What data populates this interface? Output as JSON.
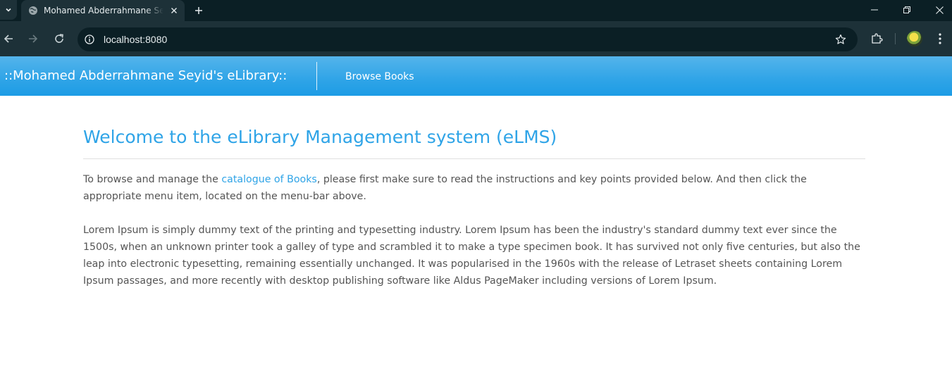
{
  "browser": {
    "tab": {
      "title": "Mohamed Abderrahmane Seyid's eLibrary",
      "favicon": "globe-icon"
    },
    "address_bar": {
      "url": "localhost:8080"
    },
    "icons": {
      "tab_list": "chevron-down-icon",
      "tab_close": "close-icon",
      "new_tab": "plus-icon",
      "minimize": "minimize-icon",
      "restore": "restore-icon",
      "close_window": "close-icon",
      "back": "back-arrow-icon",
      "forward": "forward-arrow-icon",
      "reload": "reload-icon",
      "site_info": "info-icon",
      "bookmark": "star-icon",
      "extensions": "puzzle-icon",
      "profile": "avatar",
      "menu": "more-vertical-icon"
    }
  },
  "navbar": {
    "brand": "::Mohamed Abderrahmane Seyid's eLibrary::",
    "links": [
      {
        "label": "Browse Books"
      }
    ]
  },
  "content": {
    "title": "Welcome to the eLibrary Management system (eLMS)",
    "intro": {
      "before_link": "To browse and manage the ",
      "link_text": "catalogue of Books",
      "after_link": ", please first make sure to read the instructions and key points provided below. And then click the appropriate menu item, located on the menu-bar above."
    },
    "lorem": "Lorem Ipsum is simply dummy text of the printing and typesetting industry. Lorem Ipsum has been the industry's standard dummy text ever since the 1500s, when an unknown printer took a galley of type and scrambled it to make a type specimen book. It has survived not only five centuries, but also the leap into electronic typesetting, remaining essentially unchanged. It was popularised in the 1960s with the release of Letraset sheets containing Lorem Ipsum passages, and more recently with desktop publishing software like Aldus PageMaker including versions of Lorem Ipsum."
  },
  "colors": {
    "chrome_dark": "#0b1f25",
    "chrome_toolbar": "#1d3138",
    "navbar_blue": "#2fa4e7",
    "heading_blue": "#2fa4e7",
    "body_text": "#555555"
  }
}
